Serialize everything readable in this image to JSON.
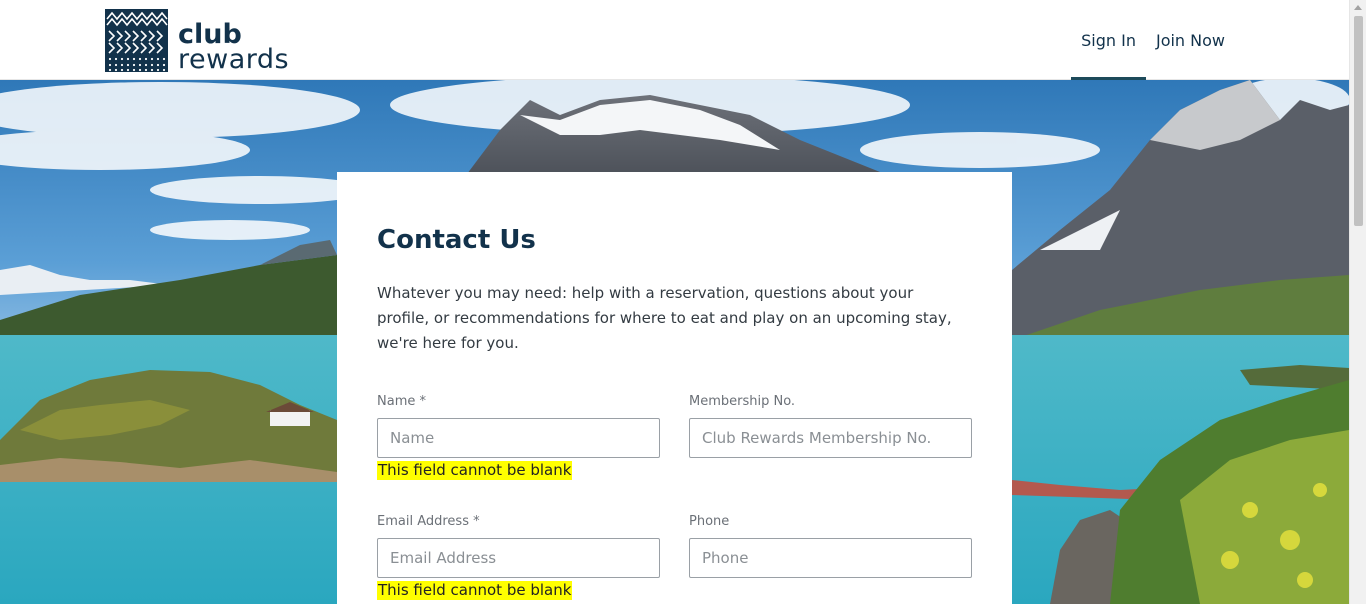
{
  "brand": {
    "line1": "club",
    "line2": "rewards"
  },
  "nav": {
    "items": [
      {
        "label": "Sign In",
        "active": true
      },
      {
        "label": "Join Now",
        "active": false
      }
    ]
  },
  "contact": {
    "title": "Contact Us",
    "intro": "Whatever you may need: help with a reservation, questions about your profile, or recommendations for where to eat and play on an upcoming stay, we're here for you.",
    "fields": {
      "name": {
        "label": "Name *",
        "placeholder": "Name",
        "value": "",
        "error": "This field cannot be blank"
      },
      "membership": {
        "label": "Membership No.",
        "placeholder": "Club Rewards Membership No.",
        "value": ""
      },
      "email": {
        "label": "Email Address *",
        "placeholder": "Email Address",
        "value": "",
        "error": "This field cannot be blank"
      },
      "phone": {
        "label": "Phone",
        "placeholder": "Phone",
        "value": ""
      }
    }
  },
  "colors": {
    "brand_navy": "#12324b",
    "nav_underline": "#1d4a5a",
    "error_highlight": "#ffff00"
  },
  "icons": {
    "logo": "club-rewards-logo-mark"
  }
}
